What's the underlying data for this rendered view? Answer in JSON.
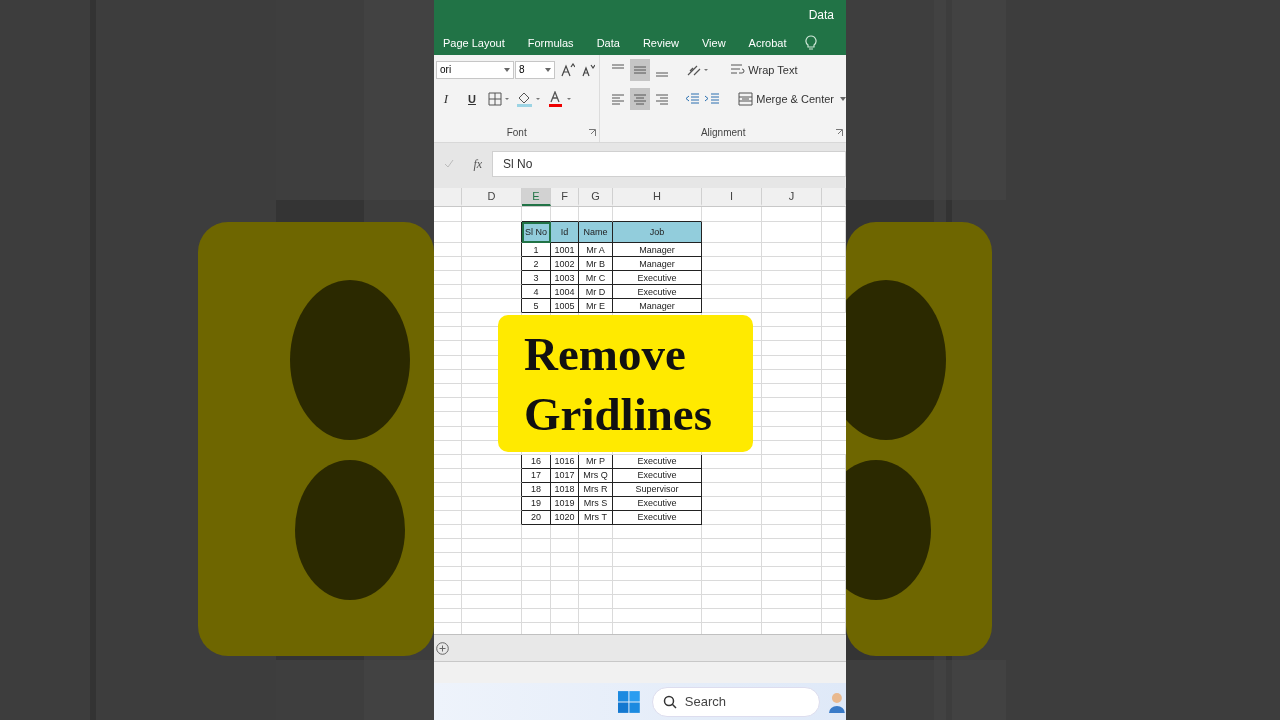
{
  "title_bar": {
    "text": "Data"
  },
  "ribbon_tabs": [
    "Page Layout",
    "Formulas",
    "Data",
    "Review",
    "View",
    "Acrobat"
  ],
  "ribbon": {
    "font_name": "ori",
    "font_size": "8",
    "italic": "I",
    "underline": "U",
    "font_group": "Font",
    "wrap_text": "Wrap Text",
    "merge_center": "Merge & Center",
    "alignment_group": "Alignment"
  },
  "formula_bar": {
    "fx": "fx",
    "value": "Sl No"
  },
  "columns": [
    {
      "label": "D",
      "selected": false
    },
    {
      "label": "E",
      "selected": true
    },
    {
      "label": "F",
      "selected": false
    },
    {
      "label": "G",
      "selected": false
    },
    {
      "label": "H",
      "selected": false
    },
    {
      "label": "I",
      "selected": false
    },
    {
      "label": "J",
      "selected": false
    }
  ],
  "table": {
    "header": [
      {
        "text": "Sl No",
        "selected": true
      },
      {
        "text": "Id",
        "selected": false
      },
      {
        "text": "Name",
        "selected": false
      },
      {
        "text": "Job",
        "selected": false
      }
    ],
    "rows": [
      [
        "1",
        "1001",
        "Mr A",
        "Manager"
      ],
      [
        "2",
        "1002",
        "Mr B",
        "Manager"
      ],
      [
        "3",
        "1003",
        "Mr C",
        "Executive"
      ],
      [
        "4",
        "1004",
        "Mr D",
        "Executive"
      ],
      [
        "5",
        "1005",
        "Mr E",
        "Manager"
      ],
      [
        "16",
        "1016",
        "Mr P",
        "Executive"
      ],
      [
        "17",
        "1017",
        "Mrs Q",
        "Executive"
      ],
      [
        "18",
        "1018",
        "Mrs R",
        "Supervisor"
      ],
      [
        "19",
        "1019",
        "Mrs S",
        "Executive"
      ],
      [
        "20",
        "1020",
        "Mrs T",
        "Executive"
      ]
    ]
  },
  "overlay": {
    "text": "Remove Gridlines"
  },
  "taskbar": {
    "search": "Search"
  }
}
